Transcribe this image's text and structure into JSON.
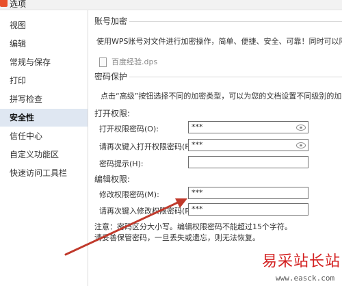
{
  "window": {
    "title": "选项"
  },
  "sidebar": {
    "items": [
      {
        "label": "视图"
      },
      {
        "label": "编辑"
      },
      {
        "label": "常规与保存"
      },
      {
        "label": "打印"
      },
      {
        "label": "拼写检查"
      },
      {
        "label": "安全性",
        "active": true
      },
      {
        "label": "信任中心"
      },
      {
        "label": "自定义功能区"
      },
      {
        "label": "快速访问工具栏"
      }
    ]
  },
  "account_encrypt": {
    "title": "账号加密",
    "desc": "使用WPS账号对文件进行加密操作，简单、便捷、安全、可靠！同时可以限定指",
    "file_name": "百度经验.dps"
  },
  "password_protect": {
    "title": "密码保护",
    "desc": "点击“高级”按钮选择不同的加密类型，可以为您的文档设置不同级别的加密保"
  },
  "open_permission": {
    "title": "打开权限:",
    "password_label": "打开权限密码(O):",
    "password_value": "***",
    "confirm_label": "请再次键入打开权限密码(P):",
    "confirm_value": "***",
    "hint_label": "密码提示(H):",
    "hint_value": ""
  },
  "edit_permission": {
    "title": "编辑权限:",
    "password_label": "修改权限密码(M):",
    "password_value": "***",
    "confirm_label": "请再次键入修改权限密码(R):",
    "confirm_value": "***"
  },
  "notes": {
    "line1": "注意：密码区分大小写。编辑权限密码不能超过15个字符。",
    "line2": "请妥善保管密码，一旦丢失或遗忘，则无法恢复。"
  },
  "watermark": {
    "text": "易采站长站",
    "url": "www.easck.com"
  },
  "annotation": {
    "arrow_color": "#c0392b"
  }
}
